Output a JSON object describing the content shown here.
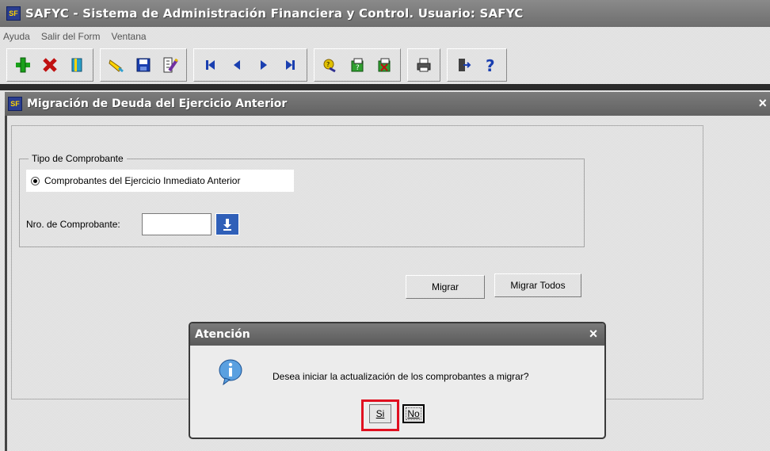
{
  "window": {
    "title": "SAFYC - Sistema de Administración Financiera y Control. Usuario: SAFYC",
    "icon": "app-icon"
  },
  "menu": [
    {
      "label": "Ayuda"
    },
    {
      "label": "Salir del Form"
    },
    {
      "label": "Ventana"
    }
  ],
  "toolbar": {
    "icons": [
      "add-record-icon",
      "delete-record-icon",
      "duplicate-icon",
      "clear-icon",
      "save-icon",
      "edit-icon",
      "first-record-icon",
      "previous-record-icon",
      "next-record-icon",
      "last-record-icon",
      "execute-query-icon",
      "enter-query-icon",
      "cancel-query-icon",
      "print-icon",
      "exit-icon",
      "help-icon"
    ]
  },
  "form": {
    "title": "Migración de Deuda del Ejercicio Anterior",
    "close_label": "×",
    "tipo_legend": "Tipo de Comprobante",
    "radio_label": "Comprobantes del Ejercicio Inmediato Anterior",
    "nro_label": "Nro. de Comprobante:",
    "nro_value": "",
    "migrar_label": "Migrar",
    "migrar_todos_label": "Migrar Todos"
  },
  "dialog": {
    "title": "Atención",
    "close_label": "×",
    "icon": "info-icon",
    "message": "Desea iniciar la actualización de los comprobantes a migrar?",
    "yes_label": "Si",
    "no_label": "No",
    "highlight_color": "#e01020"
  },
  "colors": {
    "titlebar": "#6e6e6e",
    "lov_button": "#2f5fb8"
  }
}
